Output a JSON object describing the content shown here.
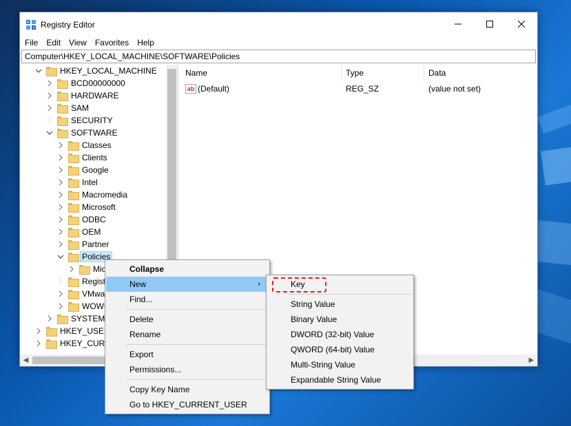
{
  "window": {
    "title": "Registry Editor",
    "address": "Computer\\HKEY_LOCAL_MACHINE\\SOFTWARE\\Policies"
  },
  "menu": [
    "File",
    "Edit",
    "View",
    "Favorites",
    "Help"
  ],
  "tree": [
    {
      "label": "HKEY_LOCAL_MACHINE",
      "level": 0,
      "expanded": true
    },
    {
      "label": "BCD00000000",
      "level": 1,
      "expanded": false
    },
    {
      "label": "HARDWARE",
      "level": 1,
      "expanded": false
    },
    {
      "label": "SAM",
      "level": 1,
      "expanded": false
    },
    {
      "label": "SECURITY",
      "level": 1,
      "expanded": null
    },
    {
      "label": "SOFTWARE",
      "level": 1,
      "expanded": true
    },
    {
      "label": "Classes",
      "level": 2,
      "expanded": false
    },
    {
      "label": "Clients",
      "level": 2,
      "expanded": false
    },
    {
      "label": "Google",
      "level": 2,
      "expanded": false
    },
    {
      "label": "Intel",
      "level": 2,
      "expanded": false
    },
    {
      "label": "Macromedia",
      "level": 2,
      "expanded": false
    },
    {
      "label": "Microsoft",
      "level": 2,
      "expanded": false
    },
    {
      "label": "ODBC",
      "level": 2,
      "expanded": false
    },
    {
      "label": "OEM",
      "level": 2,
      "expanded": false
    },
    {
      "label": "Partner",
      "level": 2,
      "expanded": false
    },
    {
      "label": "Policies",
      "level": 2,
      "expanded": true,
      "selected": true
    },
    {
      "label": "Mic",
      "level": 3,
      "expanded": false
    },
    {
      "label": "Regist",
      "level": 2,
      "expanded": null
    },
    {
      "label": "VMwa",
      "level": 2,
      "expanded": false
    },
    {
      "label": "WOW6",
      "level": 2,
      "expanded": false
    },
    {
      "label": "SYSTEM",
      "level": 1,
      "expanded": false
    },
    {
      "label": "HKEY_USERS",
      "level": 0,
      "expanded": false
    },
    {
      "label": "HKEY_CURR",
      "level": 0,
      "expanded": false
    }
  ],
  "columns": {
    "name": "Name",
    "type": "Type",
    "data": "Data"
  },
  "values": [
    {
      "name": "(Default)",
      "type": "REG_SZ",
      "data": "(value not set)",
      "icon": "string-value-icon"
    }
  ],
  "context_menu": {
    "items": [
      {
        "label": "Collapse",
        "bold": true
      },
      {
        "label": "New",
        "submenu": true,
        "highlighted": true
      },
      {
        "label": "Find..."
      },
      {
        "separator": true
      },
      {
        "label": "Delete"
      },
      {
        "label": "Rename"
      },
      {
        "separator": true
      },
      {
        "label": "Export"
      },
      {
        "label": "Permissions..."
      },
      {
        "separator": true
      },
      {
        "label": "Copy Key Name"
      },
      {
        "label": "Go to HKEY_CURRENT_USER"
      }
    ],
    "arrow": "›"
  },
  "submenu": {
    "items": [
      {
        "label": "Key",
        "annotated": true
      },
      {
        "separator": true
      },
      {
        "label": "String Value"
      },
      {
        "label": "Binary Value"
      },
      {
        "label": "DWORD (32-bit) Value"
      },
      {
        "label": "QWORD (64-bit) Value"
      },
      {
        "label": "Multi-String Value"
      },
      {
        "label": "Expandable String Value"
      }
    ]
  },
  "colors": {
    "selection": "#cce8ff",
    "menu_highlight": "#91c9f7",
    "annotation": "#e02020",
    "folder": "#f4d27c"
  }
}
